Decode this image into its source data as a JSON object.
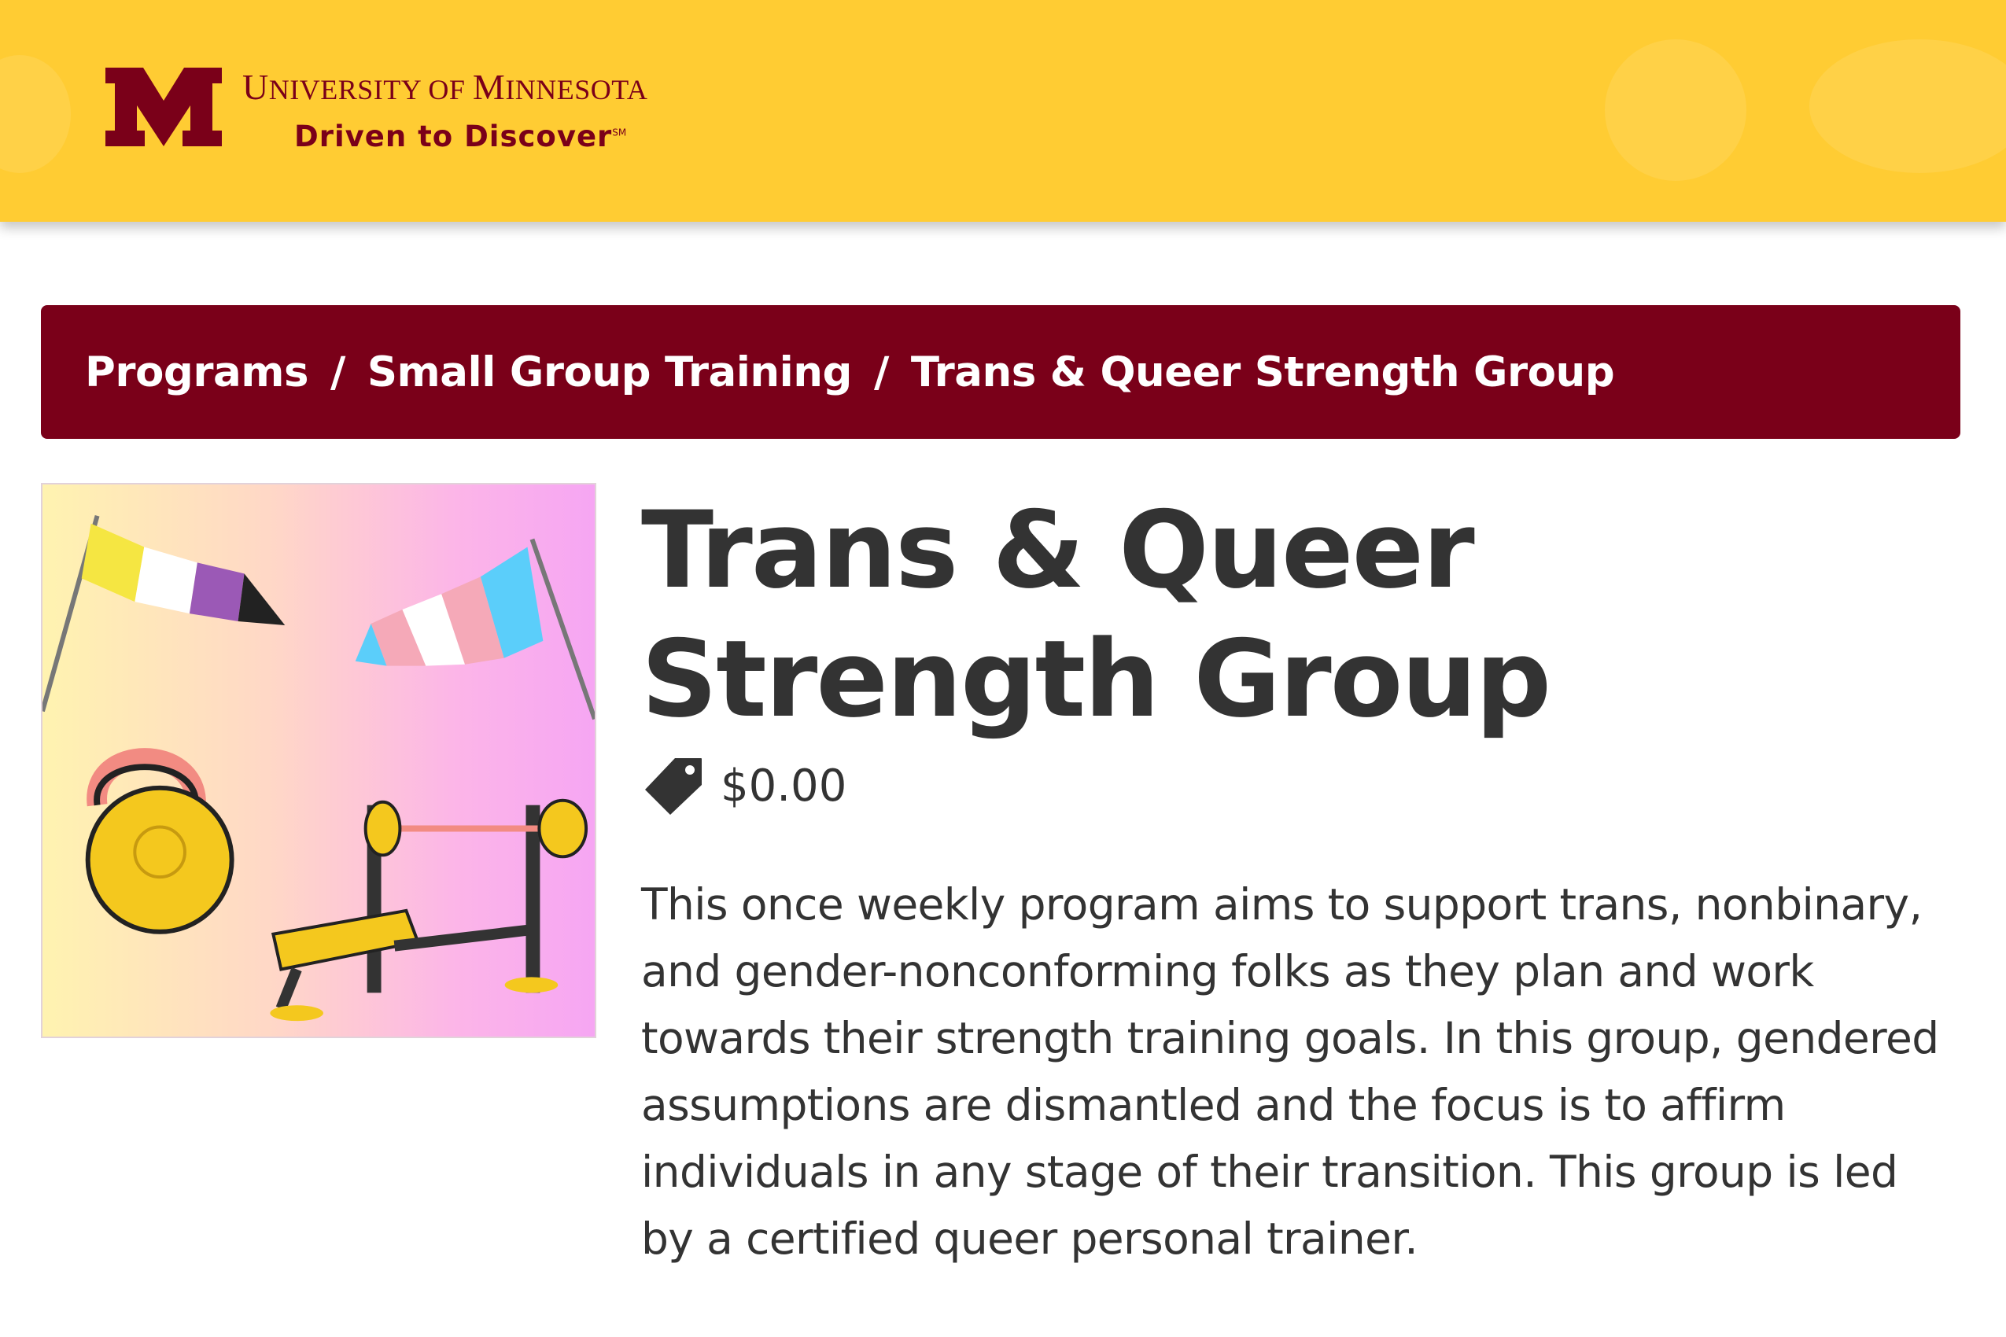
{
  "header": {
    "university_name_prefix": "U",
    "university_name_1": "NIVERSITY OF ",
    "university_name_2": "M",
    "university_name_3": "INNESOTA",
    "tagline": "Driven to Discover",
    "tagline_mark": "SM",
    "logo_icon": "block-m-logo",
    "colors": {
      "gold": "#ffcc33",
      "maroon": "#7a0019"
    }
  },
  "breadcrumb": {
    "items": [
      {
        "label": "Programs"
      },
      {
        "label": "Small Group Training"
      },
      {
        "label": "Trans & Queer Strength Group"
      }
    ],
    "separator": "/"
  },
  "program": {
    "image_icon": "program-illustration",
    "title": "Trans & Queer Strength Group",
    "price_icon": "price-tag-icon",
    "price": "$0.00",
    "description": "This once weekly program aims to support trans, nonbinary, and gender-nonconforming folks as they plan and work towards their strength training goals. In this group, gendered assumptions are dismantled and the focus is to affirm individuals in any stage of their transition. This group is led by a certified queer personal trainer."
  }
}
